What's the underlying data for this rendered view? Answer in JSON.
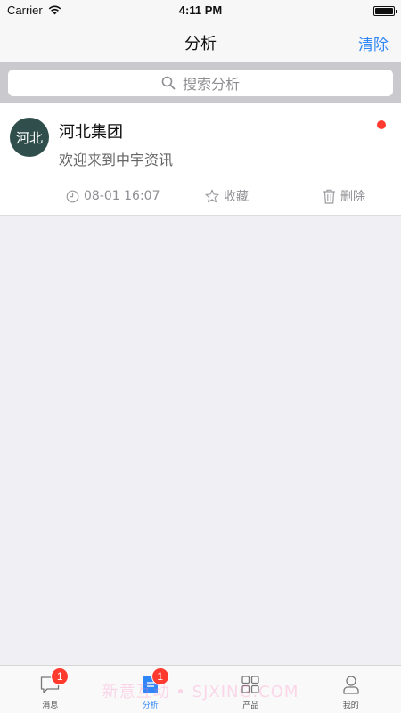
{
  "status_bar": {
    "carrier": "Carrier",
    "time": "4:11 PM"
  },
  "nav": {
    "title": "分析",
    "clear_label": "清除"
  },
  "search": {
    "placeholder": "搜索分析"
  },
  "list": [
    {
      "avatar_text": "河北",
      "title": "河北集团",
      "subtitle": "欢迎来到中宇资讯",
      "timestamp": "08-01 16:07",
      "favorite_label": "收藏",
      "delete_label": "删除",
      "unread": true
    }
  ],
  "tabs": [
    {
      "label": "消息",
      "icon": "message-bubble-icon",
      "badge": "1",
      "active": false
    },
    {
      "label": "分析",
      "icon": "document-icon",
      "badge": "1",
      "active": true
    },
    {
      "label": "产品",
      "icon": "grid-icon",
      "badge": "",
      "active": false
    },
    {
      "label": "我的",
      "icon": "person-icon",
      "badge": "",
      "active": false
    }
  ],
  "watermark": "新意互动 • SJXING.COM",
  "colors": {
    "accent": "#2f86f6",
    "badge": "#ff3b30",
    "avatar_bg": "#2f4e4c",
    "background": "#efeff4"
  }
}
